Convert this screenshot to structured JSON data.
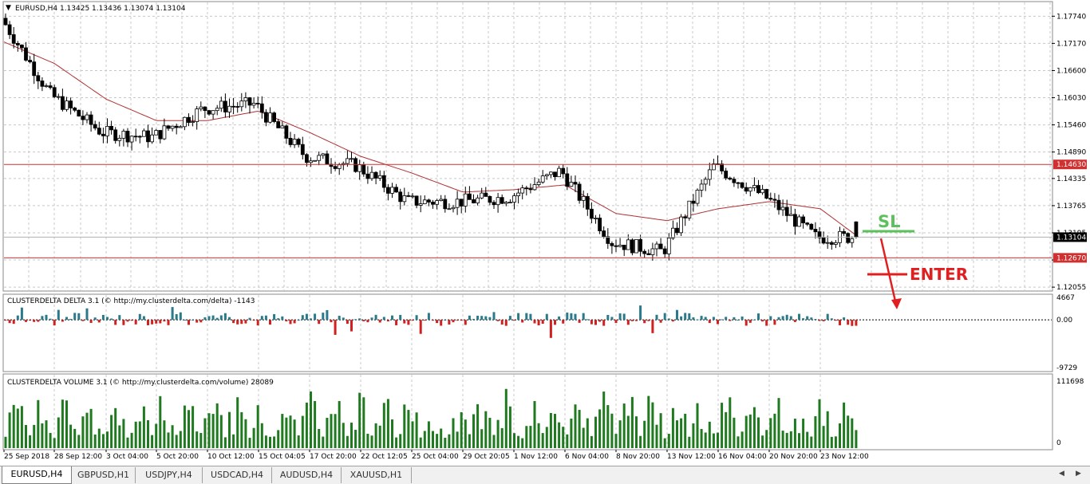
{
  "main_chart": {
    "header": "EURUSD,H4  1.13425 1.13436 1.13074 1.13104",
    "price_labels": [
      "1.17740",
      "1.17170",
      "1.16600",
      "1.16030",
      "1.15460",
      "1.14890",
      "1.14335",
      "1.13765",
      "1.13195",
      "1.12625",
      "1.12055"
    ],
    "level_labels": {
      "upper": "1.14630",
      "current": "1.13104",
      "lower": "1.12670"
    },
    "annotations": {
      "sl": "SL",
      "enter": "ENTER"
    }
  },
  "delta_panel": {
    "header": "CLUSTERDELTA DELTA 3.1 (© http://my.clusterdelta.com/delta) -1143",
    "axis_labels": [
      "4667",
      "0.00",
      "-9729"
    ]
  },
  "volume_panel": {
    "header": "CLUSTERDELTA VOLUME 3.1 (© http://my.clusterdelta.com/volume) 28089",
    "axis_labels": [
      "111698",
      "0"
    ]
  },
  "time_labels": [
    "25 Sep 2018",
    "28 Sep 12:00",
    "3 Oct 04:00",
    "5 Oct 20:00",
    "10 Oct 12:00",
    "15 Oct 04:05",
    "17 Oct 20:00",
    "22 Oct 12:05",
    "25 Oct 04:00",
    "29 Oct 20:05",
    "1 Nov 12:00",
    "6 Nov 04:00",
    "8 Nov 20:00",
    "13 Nov 12:00",
    "16 Nov 04:00",
    "20 Nov 20:00",
    "23 Nov 12:00"
  ],
  "tabs": [
    {
      "label": "EURUSD,H4",
      "active": true
    },
    {
      "label": "GBPUSD,H1",
      "active": false
    },
    {
      "label": "USDJPY,H4",
      "active": false
    },
    {
      "label": "USDCAD,H4",
      "active": false
    },
    {
      "label": "AUDUSD,H4",
      "active": false
    },
    {
      "label": "XAUUSD,H1",
      "active": false
    }
  ],
  "colors": {
    "bull_candle": "#ffffff",
    "bear_candle": "#000000",
    "moving_average": "#b03030",
    "level_line": "#d03030",
    "delta_positive": "#2a7a8c",
    "delta_negative": "#d02020",
    "volume": "#1f7a1f",
    "sl_annotation": "#5cc05c",
    "enter_annotation": "#e02020",
    "grid": "#c8c8c8"
  },
  "chart_data": {
    "type": "candlestick",
    "symbol": "EURUSD",
    "timeframe": "H4",
    "last": {
      "open": 1.13425,
      "high": 1.13436,
      "low": 1.13074,
      "close": 1.13104
    },
    "ylim": [
      1.1199,
      1.1803
    ],
    "x_range": [
      "25 Sep 2018",
      "23 Nov 12:00"
    ],
    "grid": true,
    "horizontal_levels": [
      1.1463,
      1.1267
    ],
    "price_path": [
      {
        "x": "25 Sep 2018",
        "close": 1.1775
      },
      {
        "x": "28 Sep 12:00",
        "close": 1.161
      },
      {
        "x": "3 Oct 04:00",
        "close": 1.153
      },
      {
        "x": "5 Oct 20:00",
        "close": 1.152
      },
      {
        "x": "10 Oct 12:00",
        "close": 1.158
      },
      {
        "x": "15 Oct 04:05",
        "close": 1.159
      },
      {
        "x": "17 Oct 20:00",
        "close": 1.148
      },
      {
        "x": "22 Oct 12:05",
        "close": 1.146
      },
      {
        "x": "25 Oct 04:00",
        "close": 1.1385
      },
      {
        "x": "29 Oct 20:05",
        "close": 1.1385
      },
      {
        "x": "1 Nov 12:00",
        "close": 1.1395
      },
      {
        "x": "6 Nov 04:00",
        "close": 1.145
      },
      {
        "x": "8 Nov 20:00",
        "close": 1.13
      },
      {
        "x": "13 Nov 12:00",
        "close": 1.128
      },
      {
        "x": "16 Nov 04:00",
        "close": 1.146
      },
      {
        "x": "20 Nov 20:00",
        "close": 1.1395
      },
      {
        "x": "23 Nov 12:00",
        "close": 1.131
      }
    ],
    "moving_average_path": [
      {
        "x": "25 Sep 2018",
        "value": 1.172
      },
      {
        "x": "28 Sep 12:00",
        "value": 1.1675
      },
      {
        "x": "3 Oct 04:00",
        "value": 1.16
      },
      {
        "x": "5 Oct 20:00",
        "value": 1.1555
      },
      {
        "x": "10 Oct 12:00",
        "value": 1.1555
      },
      {
        "x": "15 Oct 04:05",
        "value": 1.1575
      },
      {
        "x": "17 Oct 20:00",
        "value": 1.153
      },
      {
        "x": "22 Oct 12:05",
        "value": 1.148
      },
      {
        "x": "25 Oct 04:00",
        "value": 1.1445
      },
      {
        "x": "29 Oct 20:05",
        "value": 1.1405
      },
      {
        "x": "1 Nov 12:00",
        "value": 1.141
      },
      {
        "x": "6 Nov 04:00",
        "value": 1.142
      },
      {
        "x": "8 Nov 20:00",
        "value": 1.136
      },
      {
        "x": "13 Nov 12:00",
        "value": 1.1345
      },
      {
        "x": "16 Nov 04:00",
        "value": 1.137
      },
      {
        "x": "20 Nov 20:00",
        "value": 1.1385
      },
      {
        "x": "23 Nov 12:00",
        "value": 1.137
      }
    ],
    "indicators": {
      "delta": {
        "last": -1143,
        "ylim": [
          -9729,
          4667
        ]
      },
      "volume": {
        "last": 28089,
        "ylim": [
          0,
          111698
        ]
      }
    }
  }
}
